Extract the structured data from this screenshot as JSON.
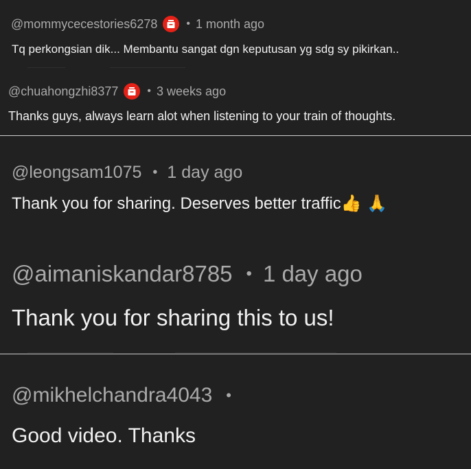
{
  "comments": [
    {
      "handle": "@mommycecestories6278",
      "has_badge": true,
      "separator": "•",
      "time": "1 month ago",
      "text": "Tq perkongsian dik... Membantu sangat dgn keputusan yg sdg sy pikirkan.."
    },
    {
      "handle": "@chuahongzhi8377",
      "has_badge": true,
      "separator": "•",
      "time": "3 weeks ago",
      "text": "Thanks guys, always learn alot when listening to your train of thoughts."
    },
    {
      "handle": "@leongsam1075",
      "has_badge": false,
      "separator": "•",
      "time": "1 day ago",
      "text": "Thank you for sharing.  Deserves better traffic",
      "emoji": "👍 🙏"
    },
    {
      "handle": "@aimaniskandar8785",
      "has_badge": false,
      "separator": "•",
      "time": "1 day ago",
      "text": "Thank you for sharing this to us!"
    },
    {
      "handle": "@mikhelchandra4043",
      "has_badge": false,
      "separator": "•",
      "time": "",
      "text": "Good video. Thanks"
    }
  ],
  "colors": {
    "background": "#212121",
    "text": "#f1f1f1",
    "meta": "#aaaaaa",
    "badge": "#e62117",
    "divider": "#d0d0d0"
  },
  "icons": {
    "badge": "members-badge-icon"
  }
}
